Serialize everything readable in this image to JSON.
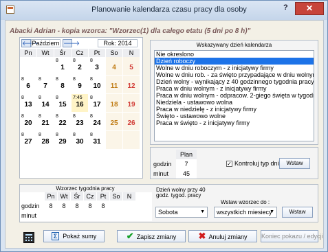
{
  "window": {
    "title": "Planowanie kalendarza czasu pracy dla osoby",
    "help_label": "?",
    "close_label": "✕"
  },
  "person": {
    "line": "Abacki Adrian  - kopia wzorca: \"Wzorzec(1) dla całego etatu (5 dni po 8 h)\""
  },
  "calendar": {
    "month": "Październ",
    "year": "Rok:  2014",
    "weekday_headers": [
      "Pn",
      "Wt",
      "Śr",
      "Cz",
      "Pt",
      "So",
      "N"
    ],
    "weeks": [
      [
        {
          "hrs": "",
          "num": ""
        },
        {
          "hrs": "",
          "num": ""
        },
        {
          "hrs": "8",
          "num": "1"
        },
        {
          "hrs": "8",
          "num": "2"
        },
        {
          "hrs": "8",
          "num": "3"
        },
        {
          "hrs": "",
          "num": "4"
        },
        {
          "hrs": "",
          "num": "5"
        }
      ],
      [
        {
          "hrs": "8",
          "num": "6"
        },
        {
          "hrs": "8",
          "num": "7"
        },
        {
          "hrs": "8",
          "num": "8"
        },
        {
          "hrs": "8",
          "num": "9"
        },
        {
          "hrs": "8",
          "num": "10"
        },
        {
          "hrs": "",
          "num": "11"
        },
        {
          "hrs": "",
          "num": "12"
        }
      ],
      [
        {
          "hrs": "8",
          "num": "13"
        },
        {
          "hrs": "8",
          "num": "14"
        },
        {
          "hrs": "8",
          "num": "15"
        },
        {
          "hrs": "7:45",
          "num": "16"
        },
        {
          "hrs": "8",
          "num": "17"
        },
        {
          "hrs": "",
          "num": "18"
        },
        {
          "hrs": "",
          "num": "19"
        }
      ],
      [
        {
          "hrs": "8",
          "num": "20"
        },
        {
          "hrs": "8",
          "num": "21"
        },
        {
          "hrs": "8",
          "num": "22"
        },
        {
          "hrs": "8",
          "num": "23"
        },
        {
          "hrs": "8",
          "num": "24"
        },
        {
          "hrs": "",
          "num": "25"
        },
        {
          "hrs": "",
          "num": "26"
        }
      ],
      [
        {
          "hrs": "8",
          "num": "27"
        },
        {
          "hrs": "8",
          "num": "28"
        },
        {
          "hrs": "8",
          "num": "29"
        },
        {
          "hrs": "8",
          "num": "30"
        },
        {
          "hrs": "8",
          "num": "31"
        },
        {
          "hrs": "",
          "num": ""
        },
        {
          "hrs": "",
          "num": ""
        }
      ]
    ]
  },
  "day_types": {
    "group_label": "Wskazywany dzień kalendarza",
    "items": [
      "Nie okreslono",
      "Dzień roboczy",
      "Wolne w dniu roboczym - z inicjatywy firmy",
      "Wolne w dniu rob. - za święto przypadające w dniu wolnym",
      "Dzień wolny - wynikający z 40 godzinnego tygodnia pracy",
      "Praca w dniu wolnym - z inicjatywy firmy",
      "Praca w dniu wolnym - odpracow. 2-giego święta w tygodniu",
      "Niedziela - ustawowo wolna",
      "Praca w niedzielę - z inicjatywy firmy",
      "Święto - ustawowo wolne",
      "Praca w święto - z inicjatywy firmy"
    ],
    "selected_index": 1
  },
  "plan": {
    "header": "Plan",
    "rows": [
      {
        "label": "godzin",
        "value": "7"
      },
      {
        "label": "minut",
        "value": "45"
      }
    ],
    "check_label": "Kontroluj typ dnia",
    "check_mark": "✓",
    "apply_label": "Wstaw"
  },
  "week_pattern": {
    "group_label": "Wzorzec tygodnia pracy",
    "headers": [
      "Pn",
      "Wt",
      "Śr",
      "Cz",
      "Pt",
      "So",
      "N"
    ],
    "rows": [
      {
        "label": "godzin",
        "values": [
          "8",
          "8",
          "8",
          "8",
          "8",
          "",
          ""
        ]
      },
      {
        "label": "minut",
        "values": [
          "",
          "",
          "",
          "",
          "",
          "",
          ""
        ]
      }
    ],
    "free_day_label_1": "Dzień wolny przy 40",
    "free_day_label_2": "godz. tygod. pracy",
    "free_day_value": "Sobota",
    "insert_pattern_label": "Wstaw wzorzec do :",
    "insert_pattern_value": "wszystkich miesiecy",
    "insert_button": "Wstaw"
  },
  "bottom": {
    "show_sums": "Pokaż sumy",
    "save": "Zapisz zmiany",
    "cancel": "Anuluj zmiany",
    "end": "Koniec pokazu / edycji"
  }
}
